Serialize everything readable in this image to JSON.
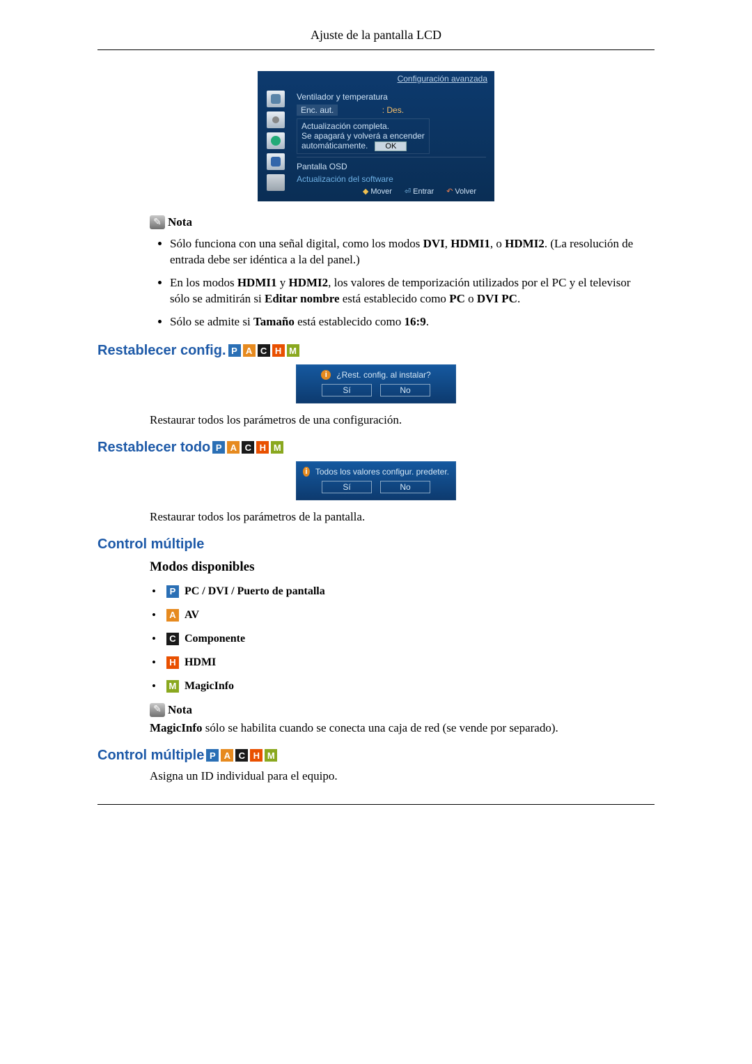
{
  "header": {
    "title": "Ajuste de la pantalla LCD"
  },
  "osd": {
    "title": "Configuración avanzada",
    "line1": "Ventilador y temperatura",
    "line2_left": "Enc. aut.",
    "line2_right": ": Des.",
    "popup1": "Actualización completa.",
    "popup2": "Se apagará y volverá a encender",
    "popup3": "automáticamente.",
    "ok": "OK",
    "line3": "Pantalla OSD",
    "line4": "Actualización del software",
    "nav_move": "Mover",
    "nav_enter": "Entrar",
    "nav_return": "Volver"
  },
  "note_label": "Nota",
  "notes1": [
    {
      "pre": "Sólo funciona con una señal digital, como los modos ",
      "b1": "DVI",
      "mid1": ", ",
      "b2": "HDMI1",
      "mid2": ", o ",
      "b3": "HDMI2",
      "post": ". (La resolución de entrada debe ser idéntica a la del panel.)"
    },
    {
      "t": "En los modos HDMI1 y HDMI2, los valores de temporización utilizados por el PC y el televisor sólo se admitirán si Editar nombre está establecido como PC o DVI PC.",
      "raw_pre": "En los modos ",
      "b1": "HDMI1",
      "mid1": " y ",
      "b2": "HDMI2",
      "mid2": ", los valores de temporización utilizados por el PC y el televisor sólo se admitirán si ",
      "b3": "Editar nombre",
      "mid3": " está establecido como ",
      "b4": "PC",
      "mid4": " o ",
      "b5": "DVI PC",
      "post": "."
    },
    {
      "pre": "Sólo se admite si ",
      "b1": "Tamaño",
      "mid1": " está establecido como ",
      "b2": "16:9",
      "post": "."
    }
  ],
  "h_reset_config": "Restablecer config.",
  "chips": {
    "P": "P",
    "A": "A",
    "C": "C",
    "H": "H",
    "M": "M"
  },
  "dialog1": {
    "q": "¿Rest. config. al instalar?",
    "yes": "Sí",
    "no": "No"
  },
  "p_reset_config": "Restaurar todos los parámetros de una configuración.",
  "h_reset_all": "Restablecer todo",
  "dialog2": {
    "q": "Todos los valores configur. predeter.",
    "yes": "Sí",
    "no": "No"
  },
  "p_reset_all": "Restaurar todos los parámetros de la pantalla.",
  "h_multi": "Control múltiple",
  "h_modes": "Modos disponibles",
  "modes": {
    "p_label": "PC / DVI / Puerto de pantalla",
    "a_label": "AV",
    "c_label": "Componente",
    "h_label": "HDMI",
    "m_label": "MagicInfo"
  },
  "note2_text_pre": "MagicInfo",
  "note2_text_post": " sólo se habilita cuando se conecta una caja de red (se vende por separado).",
  "h_multi2": "Control múltiple",
  "p_multi2": "Asigna un ID individual para el equipo."
}
